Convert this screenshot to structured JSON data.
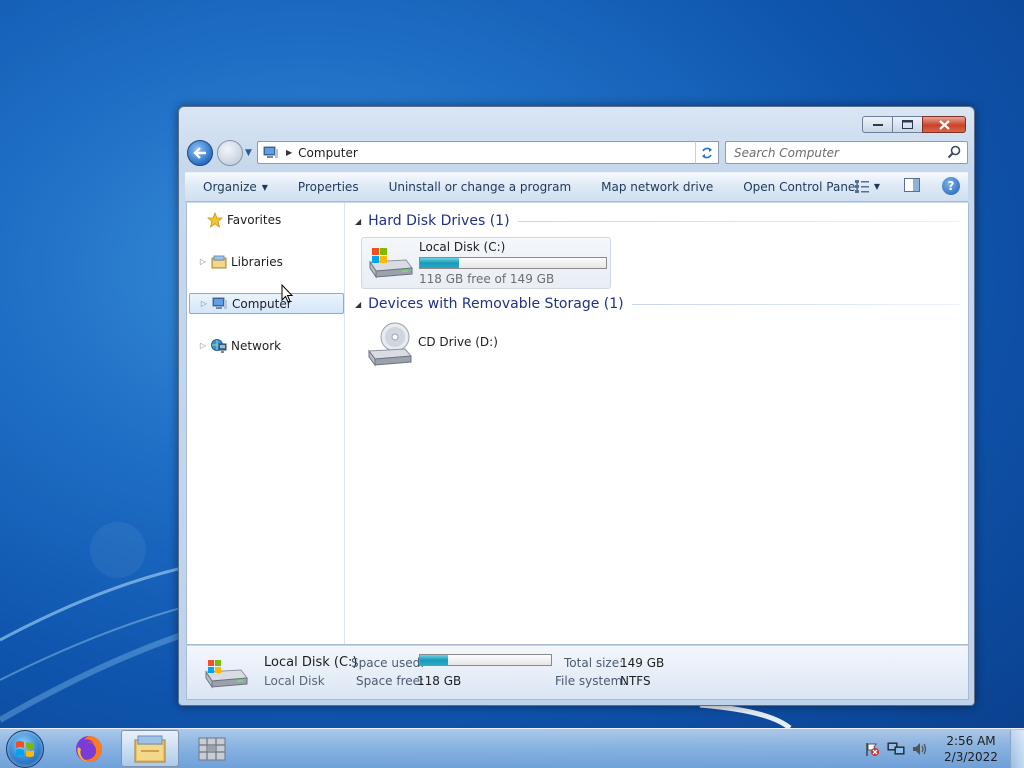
{
  "window": {
    "address": {
      "path_label": "Computer",
      "icon": "computer-icon"
    },
    "search": {
      "placeholder": "Search Computer"
    },
    "toolbar": {
      "organize": "Organize",
      "properties": "Properties",
      "uninstall": "Uninstall or change a program",
      "map_drive": "Map network drive",
      "control_panel": "Open Control Panel"
    },
    "nav": {
      "favorites": "Favorites",
      "libraries": "Libraries",
      "computer": "Computer",
      "network": "Network",
      "selected": "Computer"
    },
    "groups": {
      "hdd": {
        "title": "Hard Disk Drives (1)"
      },
      "removable": {
        "title": "Devices with Removable Storage (1)"
      }
    },
    "drives": {
      "c": {
        "name": "Local Disk (C:)",
        "free_text": "118 GB free of 149 GB",
        "used_fraction": 0.21
      },
      "d": {
        "name": "CD Drive (D:)"
      }
    },
    "details": {
      "name": "Local Disk (C:)",
      "type": "Local Disk",
      "space_used_label": "Space used:",
      "space_free_label": "Space free:",
      "space_free": "118 GB",
      "total_size_label": "Total size:",
      "total_size": "149 GB",
      "file_system_label": "File system:",
      "file_system": "NTFS",
      "used_fraction": 0.21
    }
  },
  "taskbar": {
    "apps": [
      "firefox-icon",
      "windows-explorer-icon",
      "generic-app-icon"
    ],
    "active_app": "windows-explorer-icon",
    "clock": {
      "time": "2:56 AM",
      "date": "2/3/2022"
    }
  },
  "colors": {
    "accent": "#1e3287",
    "progress": "#1b9ab8",
    "wallpaper": "#1f6fc6"
  }
}
